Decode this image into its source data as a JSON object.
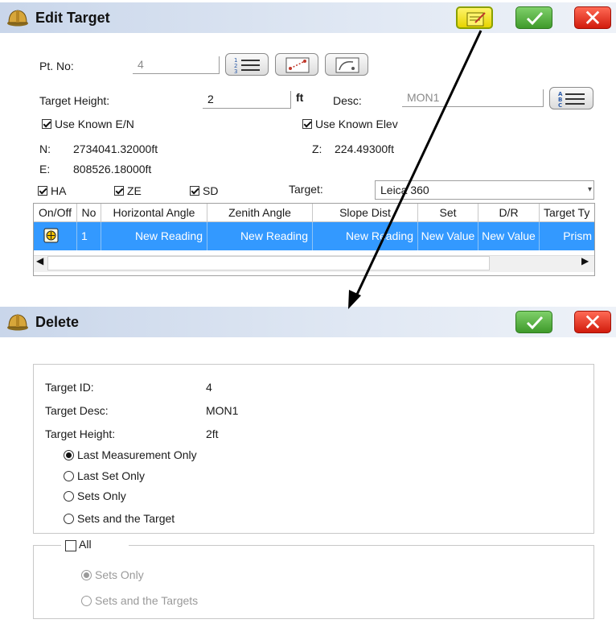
{
  "edit_target": {
    "title": "Edit Target",
    "pt_no_label": "Pt. No:",
    "pt_no_value": "4",
    "target_height_label": "Target Height:",
    "target_height_value": "2",
    "target_height_unit": "ft",
    "desc_label": "Desc:",
    "desc_value": "MON1",
    "use_known_en_label": "Use Known E/N",
    "use_known_elev_label": "Use Known Elev",
    "n_label": "N:",
    "n_value": "2734041.32000ft",
    "e_label": "E:",
    "e_value": "808526.18000ft",
    "z_label": "Z:",
    "z_value": "224.49300ft",
    "ha_label": "HA",
    "ze_label": "ZE",
    "sd_label": "SD",
    "target_label": "Target:",
    "target_value": "Leica 360",
    "grid": {
      "headers": [
        "On/Off",
        "No",
        "Horizontal Angle",
        "Zenith Angle",
        "Slope Dist",
        "Set",
        "D/R",
        "Target Ty"
      ],
      "rows": [
        [
          "",
          "1",
          "New Reading",
          "New Reading",
          "New Reading",
          "New Value",
          "New Value",
          "Prism"
        ]
      ]
    }
  },
  "delete_dialog": {
    "title": "Delete",
    "target_id_label": "Target ID:",
    "target_id_value": "4",
    "target_desc_label": "Target Desc:",
    "target_desc_value": "MON1",
    "target_height_label": "Target Height:",
    "target_height_value": "2ft",
    "options": [
      "Last Measurement Only",
      "Last Set Only",
      "Sets Only",
      "Sets and the Target"
    ],
    "selected_option": "Last Measurement Only",
    "all_label": "All",
    "all_options": [
      "Sets Only",
      "Sets and the Targets"
    ],
    "all_selected": "Sets Only"
  },
  "colors": {
    "selection": "#3399ff",
    "ok_green": "#3f9a2b",
    "cancel_red": "#d11b0c",
    "note_yellow": "#e6d400"
  }
}
